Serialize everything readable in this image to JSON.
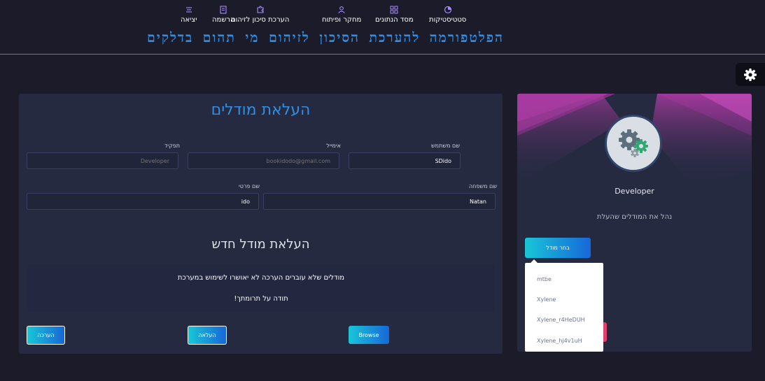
{
  "nav": {
    "items": [
      {
        "label": "סטטיסטיקות",
        "icon": "pie-chart-icon"
      },
      {
        "label": "מסד הנתונים",
        "icon": "database-icon"
      },
      {
        "label": "מחקר ופיתוח",
        "icon": "user-icon"
      },
      {
        "label": "הערכת סיכון לזיהום",
        "icon": "puzzle-icon"
      },
      {
        "label": "הרשמה",
        "icon": "register-icon"
      },
      {
        "label": "יציאה",
        "icon": "logout-icon"
      }
    ],
    "site_title": "הפלטפורמה להערכת הסיכון לזיהום מי תהום בדלקים"
  },
  "settings": {
    "icon": "gear-icon"
  },
  "upload_card": {
    "title": "העלאת מודלים",
    "fields": {
      "username": {
        "label": "שם משתמש",
        "value": "SDido"
      },
      "email": {
        "label": "אימייל",
        "placeholder": "bookidodo@gmail.com"
      },
      "role": {
        "label": "תפקיד",
        "placeholder": "Developer"
      },
      "last_name": {
        "label": "שם משפחה",
        "value": "Natan"
      },
      "first_name": {
        "label": "שם פרטי",
        "value": "ido"
      }
    },
    "new_model_title": "העלאת מודל חדש",
    "notice_line1": "מודלים שלא עוברים הערכה לא יאושרו לשימוש במערכת",
    "notice_line2": "תודה על תרומתך!",
    "buttons": {
      "browse": "Browse",
      "upload": "העלאה",
      "evaluate": "הערכה"
    }
  },
  "profile_card": {
    "role": "Developer",
    "manage_text": "נהל את המודלים שהעלת",
    "select_model_button": "בחר מודל",
    "dropdown_items": [
      "mtbe",
      "Xylene",
      "Xylene_r4HeDUH",
      "Xylene_hj4v1uH"
    ]
  },
  "colors": {
    "accent": "#2e8fe5",
    "background": "#1b1b29",
    "card": "#262a41",
    "banner": "#a8379f",
    "danger": "#e63e6d"
  }
}
